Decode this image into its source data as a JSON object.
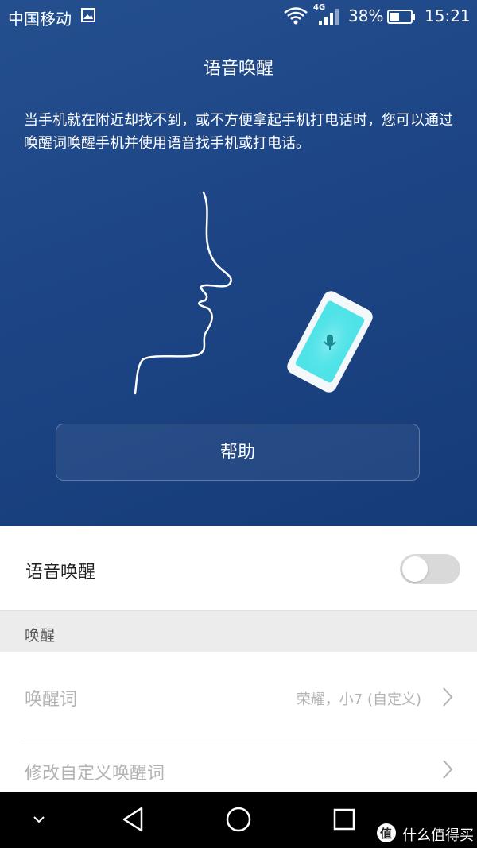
{
  "status_bar": {
    "carrier": "中国移动",
    "network_type": "4G",
    "battery_percent": "38%",
    "time": "15:21",
    "icons": [
      "gallery-icon",
      "wifi-icon",
      "signal-icon",
      "battery-icon"
    ]
  },
  "hero": {
    "title": "语音唤醒",
    "description": "当手机就在附近却找不到，或不方便拿起手机打电话时，您可以通过唤醒词唤醒手机并使用语音找手机或打电话。",
    "help_button": "帮助"
  },
  "settings": {
    "voice_wake_toggle": {
      "label": "语音唤醒",
      "enabled": false
    },
    "section_header": "唤醒",
    "wake_word": {
      "label": "唤醒词",
      "value": "荣耀，小7 (自定义)"
    },
    "edit_custom": {
      "label": "修改自定义唤醒词"
    }
  },
  "nav_bar": {
    "icons": [
      "collapse-icon",
      "back-icon",
      "home-icon",
      "recents-icon"
    ]
  },
  "watermark": {
    "badge": "值",
    "text": "什么值得买"
  },
  "colors": {
    "hero_bg": "#1d4585",
    "accent_cyan": "#4fe3e8",
    "section_bg": "#ececec",
    "disabled_text": "#b3b3b3"
  }
}
